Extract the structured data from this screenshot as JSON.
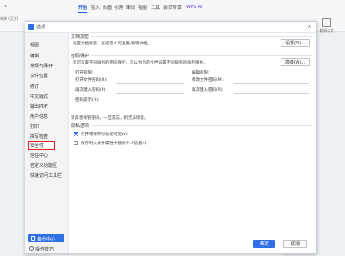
{
  "ribbon": {
    "tabs": [
      "开始",
      "插入",
      "页面",
      "引用",
      "审阅",
      "视图",
      "工具",
      "会员专享"
    ],
    "active_tab": "开始",
    "wps_ai": "WPS AI",
    "left_tool": "宋体 (正文)"
  },
  "right_tool": {
    "label": "翻阅公文"
  },
  "dialog": {
    "title": "选项",
    "close": "×",
    "sidebar": {
      "items": [
        "视图",
        "编辑",
        "常规与保存",
        "文件位置",
        "修订",
        "中文版式",
        "输出PDF",
        "用户信息",
        "打印",
        "拼写检查",
        "安全性",
        "信任中心",
        "自定义功能区",
        "快速访问工具栏"
      ],
      "active_index": 10
    },
    "backup_button": "备份中心",
    "tips_link": "操作技巧",
    "doc_encrypt": {
      "title": "文档加密",
      "desc": "设置文档加密，在指定人可查看/编辑文档。",
      "button": "设置(S)..."
    },
    "password_protect": {
      "title": "密码保护",
      "desc": "您可设置不同级别的密码保护，可以为您的文档设置不同级别的加密保护。",
      "button": "高级(A)...",
      "open_title": "打开权限:",
      "edit_title": "编辑权限:",
      "open_pw": "打开文件密码(O):",
      "reenter_open": "再次键入密码(P):",
      "hint": "密码提示(H):",
      "edit_pw": "修改文件密码(M):",
      "reenter_edit": "再次键入密码(R):"
    },
    "privacy_note": "请妥善保管密码，一旦遗忘，则无法恢复。",
    "privacy": {
      "title": "隐私选项",
      "opt1": "打开或保存时标记可见(V)",
      "opt1_checked": true,
      "opt2": "保存时从文件属性中删除个人信息(I)",
      "opt2_checked": false
    },
    "ok": "确定",
    "cancel": "取消"
  },
  "colors": {
    "accent": "#2f6fe4",
    "highlight": "#e02020"
  }
}
